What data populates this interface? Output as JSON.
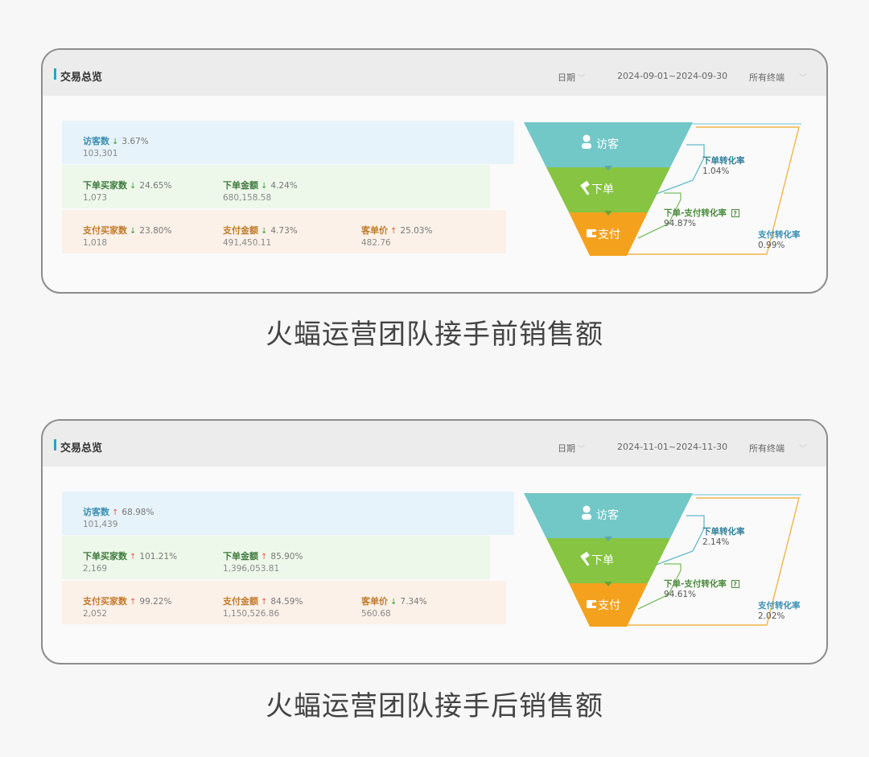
{
  "panels": [
    {
      "title": "交易总览",
      "date_label": "日期",
      "date_range": "2024-09-01~2024-09-30",
      "terminal": "所有终端",
      "visitors": {
        "label": "访客数",
        "direction": "down",
        "pct": "3.67%",
        "value": "103,301"
      },
      "order_buyers": {
        "label": "下单买家数",
        "direction": "down",
        "pct": "24.65%",
        "value": "1,073"
      },
      "order_amount": {
        "label": "下单金额",
        "direction": "down",
        "pct": "4.24%",
        "value": "680,158.58"
      },
      "pay_buyers": {
        "label": "支付买家数",
        "direction": "down",
        "pct": "23.80%",
        "value": "1,018"
      },
      "pay_amount": {
        "label": "支付金额",
        "direction": "down",
        "pct": "4.73%",
        "value": "491,450.11"
      },
      "unit_price": {
        "label": "客单价",
        "direction": "up",
        "pct": "25.03%",
        "value": "482.76"
      },
      "funnel": {
        "visit": "访客",
        "order": "下单",
        "pay": "支付"
      },
      "conv_order": {
        "label": "下单转化率",
        "value": "1.04%"
      },
      "conv_order_pay": {
        "label": "下单-支付转化率",
        "help": "?",
        "value": "94.87%"
      },
      "conv_pay": {
        "label": "支付转化率",
        "value": "0.99%"
      }
    },
    {
      "title": "交易总览",
      "date_label": "日期",
      "date_range": "2024-11-01~2024-11-30",
      "terminal": "所有终端",
      "visitors": {
        "label": "访客数",
        "direction": "up",
        "pct": "68.98%",
        "value": "101,439"
      },
      "order_buyers": {
        "label": "下单买家数",
        "direction": "up",
        "pct": "101.21%",
        "value": "2,169"
      },
      "order_amount": {
        "label": "下单金额",
        "direction": "up",
        "pct": "85.90%",
        "value": "1,396,053.81"
      },
      "pay_buyers": {
        "label": "支付买家数",
        "direction": "up",
        "pct": "99.22%",
        "value": "2,052"
      },
      "pay_amount": {
        "label": "支付金额",
        "direction": "up",
        "pct": "84.59%",
        "value": "1,150,526.86"
      },
      "unit_price": {
        "label": "客单价",
        "direction": "down",
        "pct": "7.34%",
        "value": "560.68"
      },
      "funnel": {
        "visit": "访客",
        "order": "下单",
        "pay": "支付"
      },
      "conv_order": {
        "label": "下单转化率",
        "value": "2.14%"
      },
      "conv_order_pay": {
        "label": "下单-支付转化率",
        "help": "?",
        "value": "94.61%"
      },
      "conv_pay": {
        "label": "支付转化率",
        "value": "2.02%"
      }
    }
  ],
  "captions": [
    "火蝠运营团队接手前销售额",
    "火蝠运营团队接手后销售额"
  ],
  "colors": {
    "funnel_visit": "#72c7c7",
    "funnel_order": "#86c441",
    "funnel_pay": "#f4a21e",
    "conv_order_line": "#63b9c9",
    "conv_pay_line": "#f2b54a",
    "conv_total_line": "#9ad7e3"
  },
  "icons": {
    "visit": "user-icon",
    "order": "gavel-icon",
    "pay": "wallet-icon",
    "arrow_up": "arrow-up-icon",
    "arrow_down": "arrow-down-icon"
  }
}
